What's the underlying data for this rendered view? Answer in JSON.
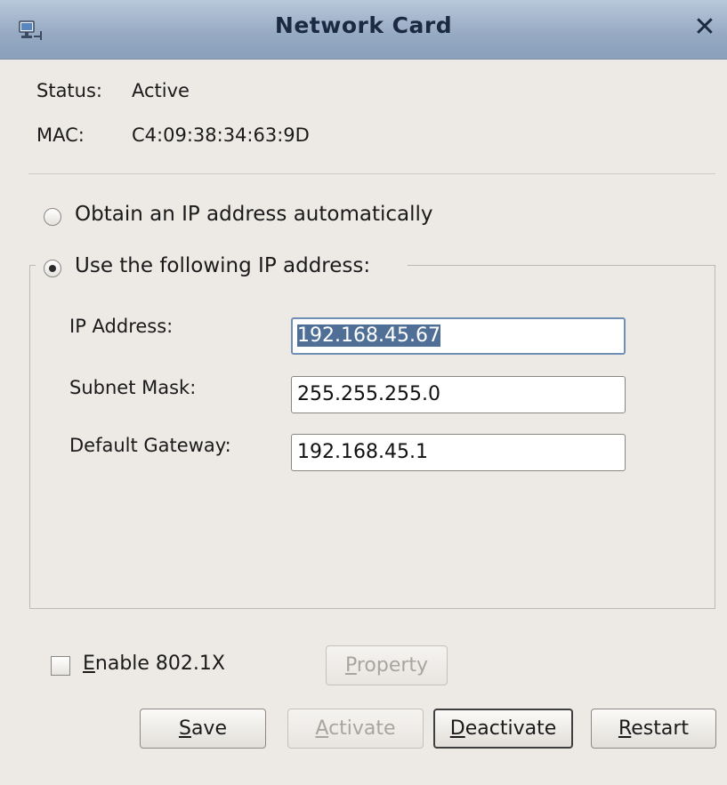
{
  "window": {
    "title": "Network Card",
    "icon": "network-card-icon",
    "close_glyph": "✕"
  },
  "info": {
    "status_label": "Status:",
    "status_value": "Active",
    "mac_label": "MAC:",
    "mac_value": "C4:09:38:34:63:9D"
  },
  "ip_mode": {
    "auto_label": "Obtain an IP address automatically",
    "manual_label": "Use the following IP address:",
    "selected": "manual"
  },
  "fields": {
    "ip_label": "IP Address:",
    "ip_value": "192.168.45.67",
    "subnet_label": "Subnet Mask:",
    "subnet_value": "255.255.255.0",
    "gateway_label": "Default Gateway:",
    "gateway_value": "192.168.45.1"
  },
  "dot1x": {
    "mnemonic": "E",
    "rest": "nable 802.1X",
    "checked": false
  },
  "buttons": {
    "property": {
      "mnemonic": "P",
      "rest": "roperty",
      "enabled": false
    },
    "save": {
      "mnemonic": "S",
      "rest": "ave",
      "enabled": true
    },
    "activate": {
      "mnemonic": "A",
      "rest": "ctivate",
      "enabled": false
    },
    "deactivate": {
      "mnemonic": "D",
      "rest": "eactivate",
      "enabled": true
    },
    "restart": {
      "mnemonic": "R",
      "rest": "estart",
      "enabled": true
    }
  },
  "colors": {
    "titlebar": "#95a9c2",
    "background": "#edeae6",
    "selection": "#4f6f96"
  }
}
